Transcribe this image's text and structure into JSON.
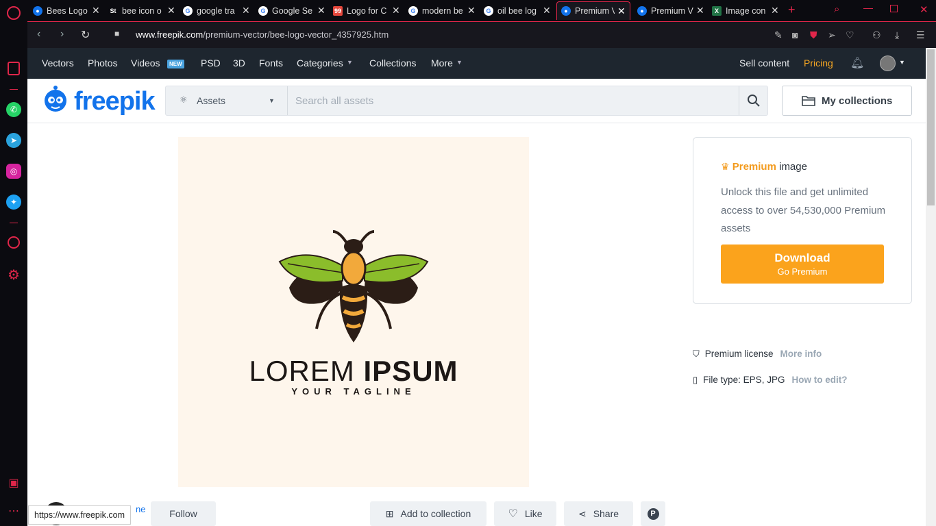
{
  "browser": {
    "tabs": [
      {
        "title": "Bees Logo",
        "favicon": "freepik-icon",
        "active": false
      },
      {
        "title": "bee icon o",
        "favicon": "st-icon",
        "active": false
      },
      {
        "title": "google tra",
        "favicon": "google-icon",
        "active": false
      },
      {
        "title": "Google Se",
        "favicon": "google-icon",
        "active": false
      },
      {
        "title": "Logo for C",
        "favicon": "99d-icon",
        "active": false
      },
      {
        "title": "modern be",
        "favicon": "google-icon",
        "active": false
      },
      {
        "title": "oil bee log",
        "favicon": "google-icon",
        "active": false
      },
      {
        "title": "Premium V",
        "favicon": "freepik-icon",
        "active": true
      },
      {
        "title": "Premium V",
        "favicon": "freepik-icon",
        "active": false
      },
      {
        "title": "Image con",
        "favicon": "x-icon",
        "active": false
      }
    ],
    "url_domain": "www.freepik.com",
    "url_path": "/premium-vector/bee-logo-vector_4357925.htm",
    "status_url": "https://www.freepik.com",
    "accent": "#e0264a"
  },
  "topnav": {
    "items": [
      "Vectors",
      "Photos",
      "Videos",
      "PSD",
      "3D",
      "Fonts",
      "Categories",
      "Collections",
      "More"
    ],
    "new_badge": "NEW",
    "sell": "Sell content",
    "pricing": "Pricing"
  },
  "header": {
    "logo": "freepik",
    "assets_label": "Assets",
    "search_placeholder": "Search all assets",
    "my_collections": "My collections"
  },
  "preview": {
    "lorem_light": "LOREM ",
    "lorem_bold": "IPSUM",
    "tagline": "YOUR TAGLINE"
  },
  "premium": {
    "title_highlight": "Premium",
    "title_rest": " image",
    "description": "Unlock this file and get unlimited access to over 54,530,000 Premium assets",
    "download_label": "Download",
    "download_sub": "Go Premium"
  },
  "info": {
    "license": "Premium license",
    "license_link": "More info",
    "file_type": "File type: EPS, JPG",
    "file_link": "How to edit?"
  },
  "actions": {
    "follow": "Follow",
    "author_partial": "ne",
    "add_collection": "Add to collection",
    "like": "Like",
    "share": "Share"
  }
}
